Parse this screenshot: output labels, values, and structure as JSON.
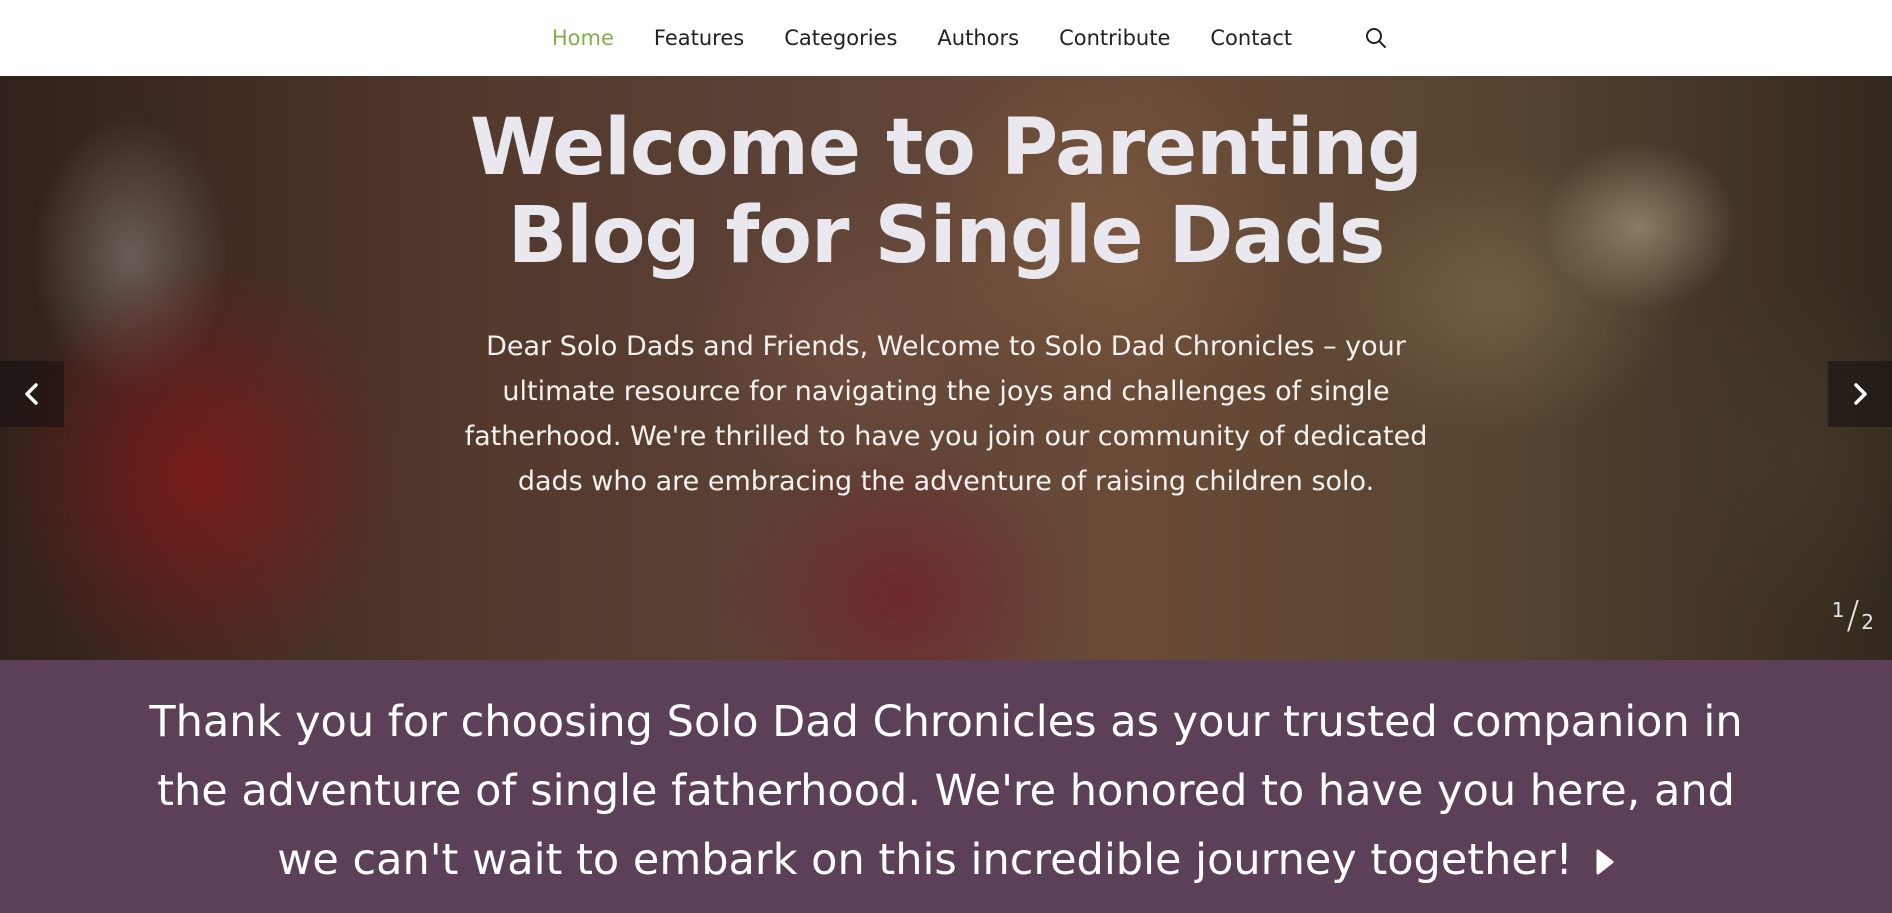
{
  "nav": {
    "items": [
      {
        "label": "Home",
        "active": true
      },
      {
        "label": "Features",
        "active": false
      },
      {
        "label": "Categories",
        "active": false
      },
      {
        "label": "Authors",
        "active": false
      },
      {
        "label": "Contribute",
        "active": false
      },
      {
        "label": "Contact",
        "active": false
      }
    ],
    "search_icon": "search-icon",
    "active_color": "#7fb04c"
  },
  "hero": {
    "title": "Welcome to Parenting Blog for Single Dads",
    "text": "Dear Solo Dads and Friends, Welcome to Solo Dad Chronicles – your ultimate resource for navigating the joys and challenges of single fatherhood. We're thrilled to have you join our community of dedicated dads who are embracing the adventure of raising children solo.",
    "slider": {
      "current": "1",
      "separator": "/",
      "total": "2"
    },
    "prev_icon": "chevron-left-icon",
    "next_icon": "chevron-right-icon"
  },
  "banner": {
    "text": "Thank you for choosing Solo Dad Chronicles as your trusted companion in the adventure of single fatherhood. We're honored to have you here, and we can't wait to embark on this incredible journey together!",
    "background": "#5c4057",
    "icon": "play-icon"
  }
}
